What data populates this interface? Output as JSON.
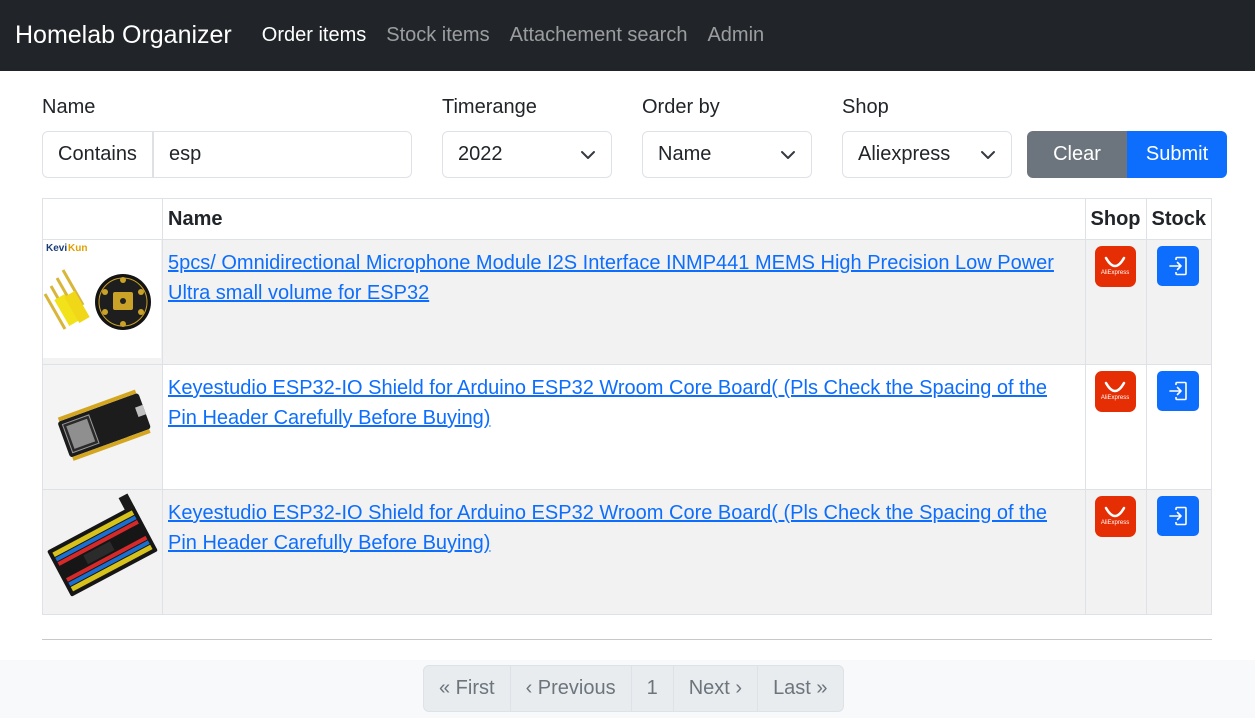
{
  "navbar": {
    "brand": "Homelab Organizer",
    "links": [
      {
        "label": "Order items",
        "active": true
      },
      {
        "label": "Stock items",
        "active": false
      },
      {
        "label": "Attachement search",
        "active": false
      },
      {
        "label": "Admin",
        "active": false
      }
    ]
  },
  "filters": {
    "name_label": "Name",
    "name_mode": "Contains",
    "name_value": "esp",
    "timerange_label": "Timerange",
    "timerange_value": "2022",
    "orderby_label": "Order by",
    "orderby_value": "Name",
    "shop_label": "Shop",
    "shop_value": "Aliexpress",
    "clear_label": "Clear",
    "submit_label": "Submit"
  },
  "table": {
    "headers": {
      "image": "",
      "name": "Name",
      "shop": "Shop",
      "stock": "Stock"
    },
    "rows": [
      {
        "name": "5pcs/ Omnidirectional Microphone Module I2S Interface INMP441 MEMS High Precision Low Power Ultra small volume for ESP32",
        "shop_icon": "aliexpress-logo",
        "image_brand": "KeviKun"
      },
      {
        "name": "Keyestudio ESP32-IO Shield for Arduino ESP32 Wroom Core Board( (Pls Check the Spacing of the Pin Header Carefully Before Buying)",
        "shop_icon": "aliexpress-logo"
      },
      {
        "name": "Keyestudio ESP32-IO Shield for Arduino ESP32 Wroom Core Board( (Pls Check the Spacing of the Pin Header Carefully Before Buying)",
        "shop_icon": "aliexpress-logo"
      }
    ],
    "shop_logo_text": "AliExpress"
  },
  "pagination": {
    "first": "« First",
    "previous": "‹ Previous",
    "current": "1",
    "next": "Next ›",
    "last": "Last »"
  },
  "colors": {
    "navbar_bg": "#212529",
    "primary": "#0d6efd",
    "secondary": "#6c757d",
    "aliexpress": "#e62e04"
  }
}
